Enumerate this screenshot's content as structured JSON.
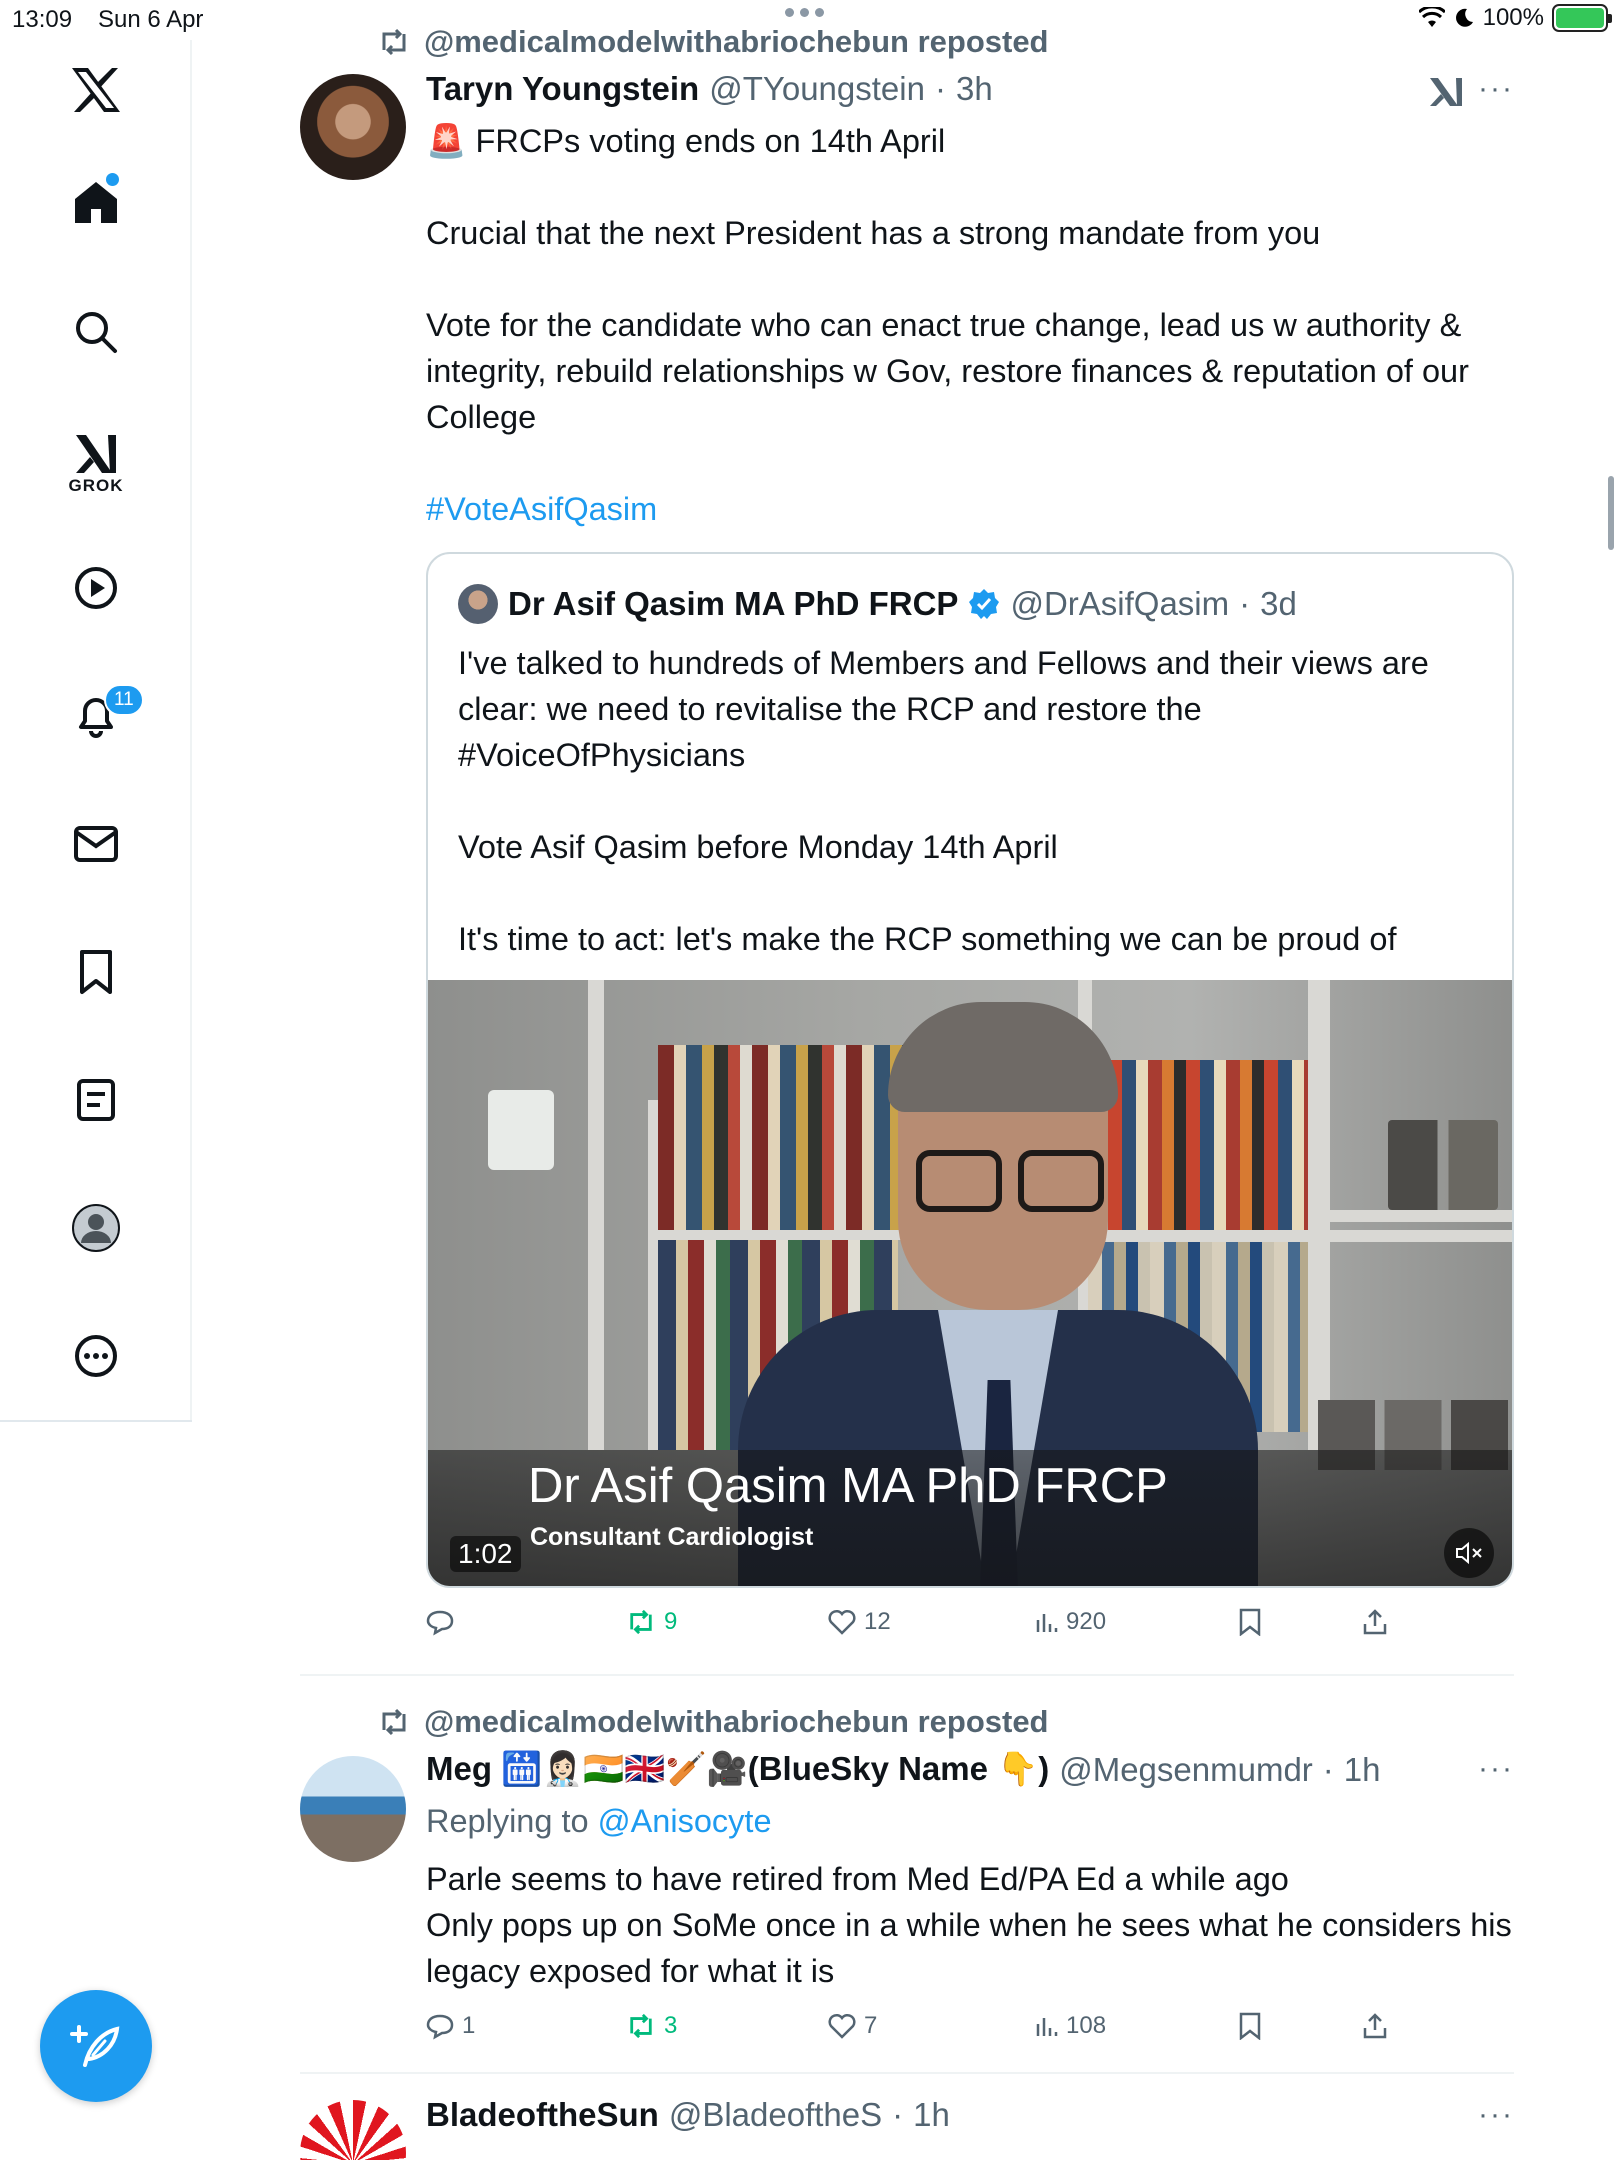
{
  "status_bar": {
    "time": "13:09",
    "date": "Sun 6 Apr",
    "battery": "100%"
  },
  "sidebar": {
    "grok_label": "GROK",
    "notifications_badge": "11"
  },
  "posts": [
    {
      "repost_label": "@medicalmodelwithabriochebun reposted",
      "name": "Taryn Youngstein",
      "handle": "@TYoungstein",
      "time": "3h",
      "text_line1": "🚨 FRCPs voting ends on 14th April",
      "text_line2": "Crucial that the next President has a strong mandate from you",
      "text_line3": "Vote for the candidate who can enact true change, lead us w authority & integrity, rebuild relationships w Gov, restore finances & reputation of our College",
      "hashtag": "#VoteAsifQasim",
      "quote": {
        "name": "Dr Asif Qasim MA PhD FRCP",
        "handle": "@DrAsifQasim",
        "time": "3d",
        "text_line1": "I've talked to hundreds of Members and Fellows and their views are clear: we need to revitalise the RCP and restore the #VoiceOfPhysicians",
        "text_line2": "Vote Asif Qasim before Monday 14th April",
        "text_line3": "It's time to act: let's make the RCP something we can be proud of",
        "video_caption_name": "Dr Asif Qasim MA PhD FRCP",
        "video_caption_role": "Consultant Cardiologist",
        "video_duration": "1:02"
      },
      "reposts": "9",
      "likes": "12",
      "views": "920"
    },
    {
      "repost_label": "@medicalmodelwithabriochebun reposted",
      "name": "Meg 🛗👩🏻‍⚕️🇮🇳🇬🇧🏏🎥(BlueSky Name 👇)",
      "handle": "@Megsenmumdr",
      "time": "1h",
      "replying_prefix": "Replying to",
      "replying_to": "@Anisocyte",
      "text_line1": "Parle seems to have retired from Med Ed/PA Ed a while ago",
      "text_line2": "Only pops up on SoMe once in a while when he sees what he considers his legacy exposed for what it is",
      "replies": "1",
      "reposts": "3",
      "likes": "7",
      "views": "108"
    },
    {
      "name": "BladeoftheSun",
      "handle": "@BladeoftheS",
      "time": "1h"
    }
  ],
  "colors": {
    "accent": "#1d9bf0",
    "repost_green": "#00ba7c",
    "secondary_text": "#536471"
  }
}
